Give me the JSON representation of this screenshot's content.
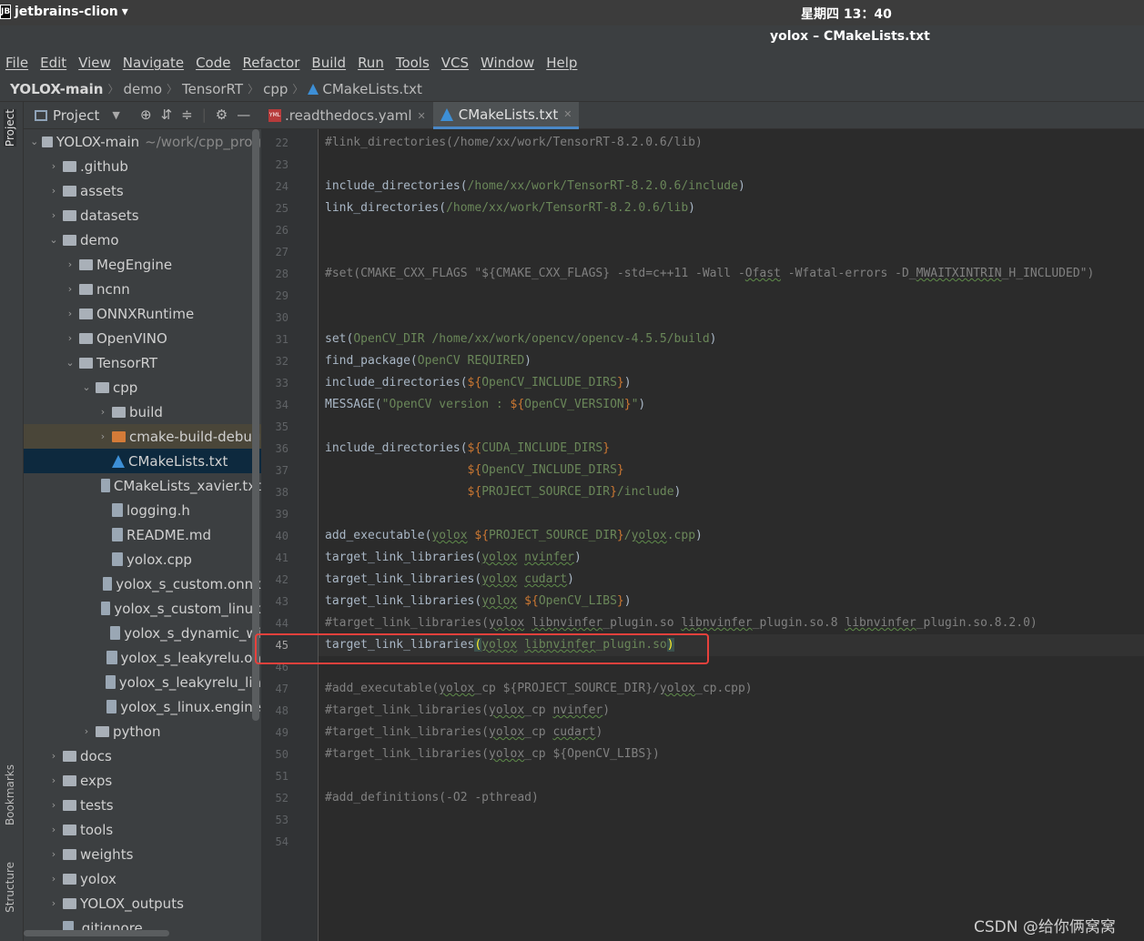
{
  "system": {
    "app_name": "jetbrains-clion",
    "clock": "星期四 13：40"
  },
  "window": {
    "title": "yolox – CMakeLists.txt"
  },
  "menu": [
    "File",
    "Edit",
    "View",
    "Navigate",
    "Code",
    "Refactor",
    "Build",
    "Run",
    "Tools",
    "VCS",
    "Window",
    "Help"
  ],
  "breadcrumb": [
    "YOLOX-main",
    "demo",
    "TensorRT",
    "cpp",
    "CMakeLists.txt"
  ],
  "left_strip": {
    "project": "Project",
    "bookmarks": "Bookmarks",
    "structure": "Structure"
  },
  "project_panel": {
    "title": "Project",
    "tree": [
      {
        "indent": 0,
        "arrow": "⌄",
        "icon": "folder",
        "label": "YOLOX-main",
        "hint": "~/work/cpp_prog"
      },
      {
        "indent": 1,
        "arrow": "›",
        "icon": "folder",
        "label": ".github"
      },
      {
        "indent": 1,
        "arrow": "›",
        "icon": "folder",
        "label": "assets"
      },
      {
        "indent": 1,
        "arrow": "›",
        "icon": "folder",
        "label": "datasets"
      },
      {
        "indent": 1,
        "arrow": "⌄",
        "icon": "folder",
        "label": "demo"
      },
      {
        "indent": 2,
        "arrow": "›",
        "icon": "folder",
        "label": "MegEngine"
      },
      {
        "indent": 2,
        "arrow": "›",
        "icon": "folder",
        "label": "ncnn"
      },
      {
        "indent": 2,
        "arrow": "›",
        "icon": "folder",
        "label": "ONNXRuntime"
      },
      {
        "indent": 2,
        "arrow": "›",
        "icon": "folder",
        "label": "OpenVINO"
      },
      {
        "indent": 2,
        "arrow": "⌄",
        "icon": "folder",
        "label": "TensorRT"
      },
      {
        "indent": 3,
        "arrow": "⌄",
        "icon": "folder",
        "label": "cpp"
      },
      {
        "indent": 4,
        "arrow": "›",
        "icon": "folder",
        "label": "build"
      },
      {
        "indent": 4,
        "arrow": "›",
        "icon": "folder-orange",
        "label": "cmake-build-debug",
        "state": "hl"
      },
      {
        "indent": 4,
        "arrow": "",
        "icon": "cmake",
        "label": "CMakeLists.txt",
        "state": "sel"
      },
      {
        "indent": 4,
        "arrow": "",
        "icon": "file",
        "label": "CMakeLists_xavier.txt"
      },
      {
        "indent": 4,
        "arrow": "",
        "icon": "file",
        "label": "logging.h"
      },
      {
        "indent": 4,
        "arrow": "",
        "icon": "file",
        "label": "README.md"
      },
      {
        "indent": 4,
        "arrow": "",
        "icon": "file",
        "label": "yolox.cpp"
      },
      {
        "indent": 4,
        "arrow": "",
        "icon": "file",
        "label": "yolox_s_custom.onnx"
      },
      {
        "indent": 4,
        "arrow": "",
        "icon": "file",
        "label": "yolox_s_custom_linux"
      },
      {
        "indent": 4,
        "arrow": "",
        "icon": "file",
        "label": "yolox_s_dynamic_wi"
      },
      {
        "indent": 4,
        "arrow": "",
        "icon": "file",
        "label": "yolox_s_leakyrelu.on"
      },
      {
        "indent": 4,
        "arrow": "",
        "icon": "file",
        "label": "yolox_s_leakyrelu_lin"
      },
      {
        "indent": 4,
        "arrow": "",
        "icon": "file",
        "label": "yolox_s_linux.engine"
      },
      {
        "indent": 3,
        "arrow": "›",
        "icon": "folder",
        "label": "python"
      },
      {
        "indent": 1,
        "arrow": "›",
        "icon": "folder",
        "label": "docs"
      },
      {
        "indent": 1,
        "arrow": "›",
        "icon": "folder",
        "label": "exps"
      },
      {
        "indent": 1,
        "arrow": "›",
        "icon": "folder",
        "label": "tests"
      },
      {
        "indent": 1,
        "arrow": "›",
        "icon": "folder",
        "label": "tools"
      },
      {
        "indent": 1,
        "arrow": "›",
        "icon": "folder",
        "label": "weights"
      },
      {
        "indent": 1,
        "arrow": "›",
        "icon": "folder",
        "label": "yolox"
      },
      {
        "indent": 1,
        "arrow": "›",
        "icon": "folder",
        "label": "YOLOX_outputs"
      },
      {
        "indent": 1,
        "arrow": "",
        "icon": "file",
        "label": ".gitignore"
      }
    ]
  },
  "tabs": [
    {
      "label": ".readthedocs.yaml",
      "active": false
    },
    {
      "label": "CMakeLists.txt",
      "active": true
    }
  ],
  "editor": {
    "current_line": 45,
    "lines": [
      {
        "n": 22,
        "html": "<span class='cmt'>#link_directories(/home/xx/work/TensorRT-8.2.0.6/lib)</span>"
      },
      {
        "n": 23,
        "html": ""
      },
      {
        "n": 24,
        "html": "include_directories(<span class='gr'>/home/xx/work/TensorRT-8.2.0.6/include</span>)"
      },
      {
        "n": 25,
        "html": "link_directories(<span class='gr'>/home/xx/work/TensorRT-8.2.0.6/lib</span>)"
      },
      {
        "n": 26,
        "html": ""
      },
      {
        "n": 27,
        "html": ""
      },
      {
        "n": 28,
        "html": "<span class='cmt'>#set(CMAKE_CXX_FLAGS \"${CMAKE_CXX_FLAGS} -std=c++11 -Wall -<span class='wav'>Ofast</span> -Wfatal-errors -D_<span class='wav'>MWAITXINTRIN</span>_H_INCLUDED\")</span>"
      },
      {
        "n": 29,
        "html": ""
      },
      {
        "n": 30,
        "html": ""
      },
      {
        "n": 31,
        "html": "set(<span class='gr'>OpenCV_DIR</span> <span class='gr'>/home/xx/work/opencv/opencv-4.5.5/build</span>)"
      },
      {
        "n": 32,
        "html": "find_package(<span class='gr'>OpenCV REQUIRED</span>)"
      },
      {
        "n": 33,
        "html": "include_directories(<span class='var'>${</span><span class='gr'>OpenCV_INCLUDE_DIRS</span><span class='var'>}</span>)"
      },
      {
        "n": 34,
        "html": "MESSAGE(<span class='str'>\"OpenCV version : </span><span class='var'>${</span><span class='gr'>OpenCV_VERSION</span><span class='var'>}</span><span class='str'>\"</span>)"
      },
      {
        "n": 35,
        "html": ""
      },
      {
        "n": 36,
        "html": "include_directories(<span class='var'>${</span><span class='gr'>CUDA_INCLUDE_DIRS</span><span class='var'>}</span>"
      },
      {
        "n": 37,
        "html": "                    <span class='var'>${</span><span class='gr'>OpenCV_INCLUDE_DIRS</span><span class='var'>}</span>"
      },
      {
        "n": 38,
        "html": "                    <span class='var'>${</span><span class='gr'>PROJECT_SOURCE_DIR</span><span class='var'>}</span><span class='gr'>/include</span>)"
      },
      {
        "n": 39,
        "html": ""
      },
      {
        "n": 40,
        "html": "add_executable(<span class='gr wav'>yolox</span> <span class='var'>${</span><span class='gr'>PROJECT_SOURCE_DIR</span><span class='var'>}</span><span class='gr'>/<span class='wav'>yolox</span>.cpp</span>)"
      },
      {
        "n": 41,
        "html": "target_link_libraries(<span class='gr wav'>yolox</span> <span class='gr wav'>nvinfer</span>)"
      },
      {
        "n": 42,
        "html": "target_link_libraries(<span class='gr wav'>yolox</span> <span class='gr wav'>cudart</span>)"
      },
      {
        "n": 43,
        "html": "target_link_libraries(<span class='gr wav'>yolox</span> <span class='var'>${</span><span class='gr'>OpenCV_LIBS</span><span class='var'>}</span>)"
      },
      {
        "n": 44,
        "html": "<span class='cmt'>#target_link_libraries(<span class='wav'>yolox</span> <span class='wav'>libnvinfer</span>_plugin.so <span class='wav'>libnvinfer</span>_plugin.so.8 <span class='wav'>libnvinfer</span>_plugin.so.8.2.0)</span>"
      },
      {
        "n": 45,
        "html": "target_link_libraries<span class='brk'>(</span><span class='gr wav'>yolox</span> <span class='gr'><span class='wav'>libnvinfer</span>_plugin.so</span><span class='brk'>)</span>"
      },
      {
        "n": 46,
        "html": ""
      },
      {
        "n": 47,
        "html": "<span class='cmt'>#add_executable(<span class='wav'>yolox</span>_cp ${PROJECT_SOURCE_DIR}/<span class='wav'>yolox</span>_cp.cpp)</span>"
      },
      {
        "n": 48,
        "html": "<span class='cmt'>#target_link_libraries(<span class='wav'>yolox</span>_cp <span class='wav'>nvinfer</span>)</span>"
      },
      {
        "n": 49,
        "html": "<span class='cmt'>#target_link_libraries(<span class='wav'>yolox</span>_cp <span class='wav'>cudart</span>)</span>"
      },
      {
        "n": 50,
        "html": "<span class='cmt'>#target_link_libraries(<span class='wav'>yolox</span>_cp ${OpenCV_LIBS})</span>"
      },
      {
        "n": 51,
        "html": ""
      },
      {
        "n": 52,
        "html": "<span class='cmt'>#add_definitions(-O2 -pthread)</span>"
      },
      {
        "n": 53,
        "html": ""
      },
      {
        "n": 54,
        "html": ""
      }
    ]
  },
  "watermark": "CSDN @给你俩窝窝"
}
